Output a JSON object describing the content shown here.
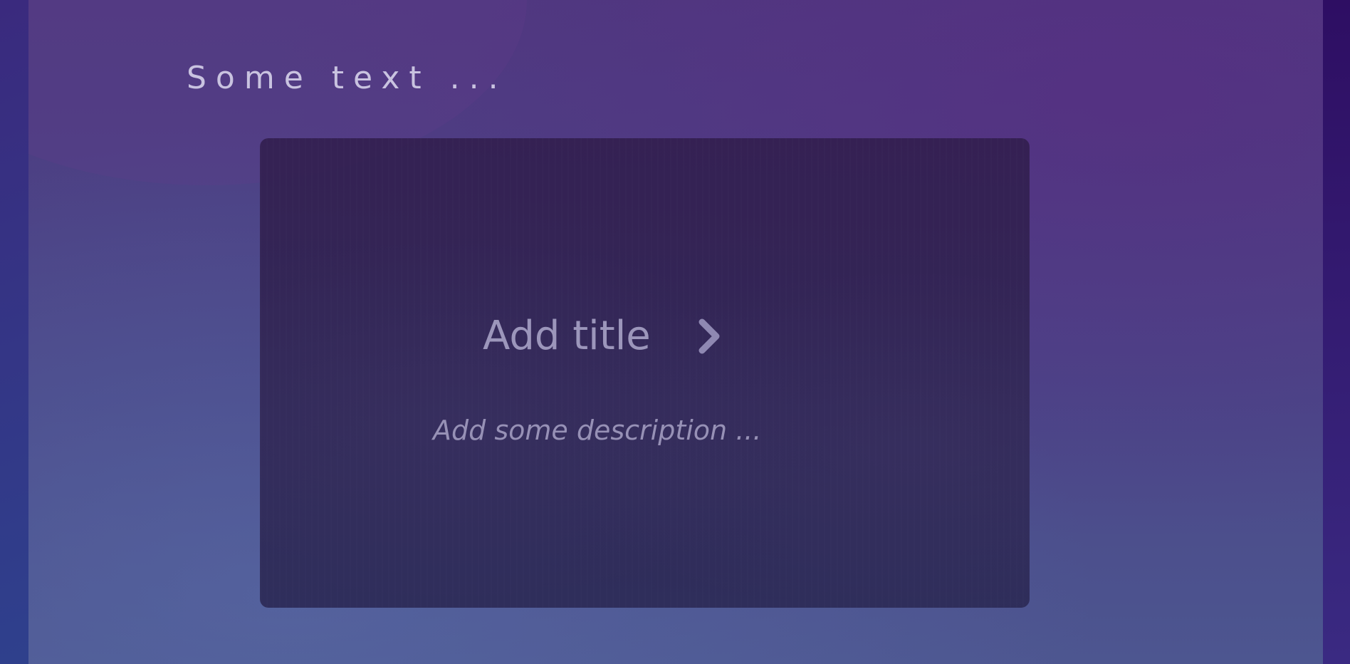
{
  "page": {
    "heading": "Some text ..."
  },
  "card": {
    "title": "Add title",
    "description": "Add some description ..."
  },
  "icons": {
    "title_arrow": "chevron-right-icon"
  },
  "colors": {
    "heading_text": "#c9c3e0",
    "card_text": "#9c96bb",
    "card_background": "#2e264f"
  }
}
